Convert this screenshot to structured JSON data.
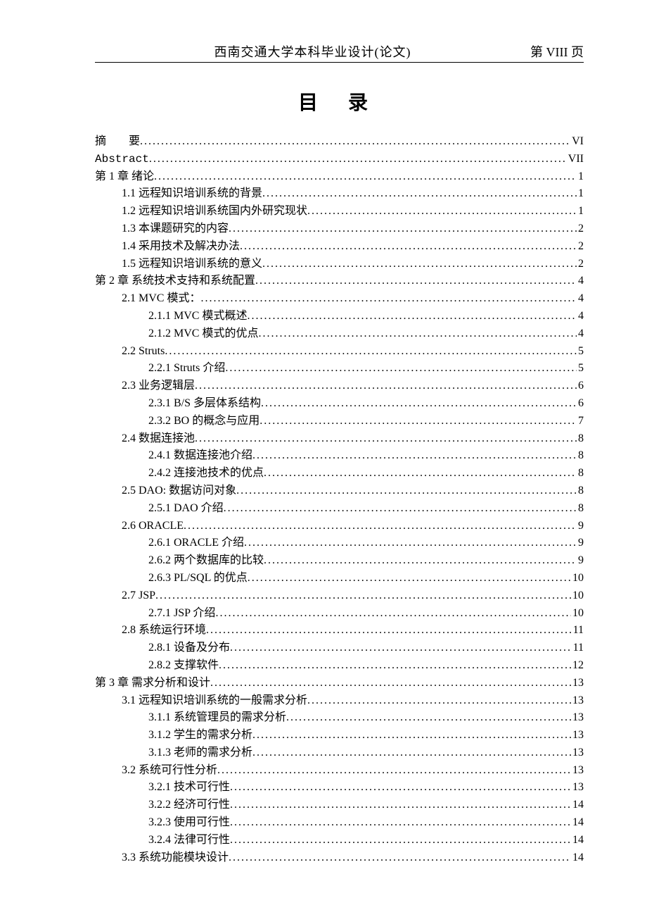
{
  "header": {
    "center": "西南交通大学本科毕业设计(论文)",
    "right": "第 VIII 页"
  },
  "title": "目 录",
  "toc": [
    {
      "level": 0,
      "label": "摘　　要",
      "page": "VI"
    },
    {
      "level": 0,
      "label": "Abstract",
      "page": "VII",
      "latin": true
    },
    {
      "level": 0,
      "label": "第 1 章 绪论",
      "page": "1"
    },
    {
      "level": 1,
      "label": "1.1 远程知识培训系统的背景 ",
      "page": "1"
    },
    {
      "level": 1,
      "label": "1.2 远程知识培训系统国内外研究现状 ",
      "page": "1"
    },
    {
      "level": 1,
      "label": "1.3 本课题研究的内容 ",
      "page": "2"
    },
    {
      "level": 1,
      "label": "1.4 采用技术及解决办法 ",
      "page": "2"
    },
    {
      "level": 1,
      "label": "1.5 远程知识培训系统的意义 ",
      "page": "2"
    },
    {
      "level": 0,
      "label": "第 2 章 系统技术支持和系统配置",
      "page": "4"
    },
    {
      "level": 1,
      "label": "2.1 MVC 模式：",
      "page": "4"
    },
    {
      "level": 2,
      "label": "2.1.1 MVC 模式概述 ",
      "page": "4"
    },
    {
      "level": 2,
      "label": "2.1.2 MVC 模式的优点 ",
      "page": "4"
    },
    {
      "level": 1,
      "label": "2.2 Struts ",
      "page": "5"
    },
    {
      "level": 2,
      "label": "2.2.1 Struts 介绍 ",
      "page": "5"
    },
    {
      "level": 1,
      "label": "2.3 业务逻辑层 ",
      "page": "6"
    },
    {
      "level": 2,
      "label": "2.3.1 B/S 多层体系结构 ",
      "page": "6"
    },
    {
      "level": 2,
      "label": "2.3.2 BO 的概念与应用 ",
      "page": "7"
    },
    {
      "level": 1,
      "label": "2.4 数据连接池 ",
      "page": "8"
    },
    {
      "level": 2,
      "label": "2.4.1 数据连接池介绍",
      "page": "8"
    },
    {
      "level": 2,
      "label": "2.4.2 连接池技术的优点",
      "page": "8"
    },
    {
      "level": 1,
      "label": "2.5 DAO: 数据访问对象 ",
      "page": "8"
    },
    {
      "level": 2,
      "label": "2.5.1 DAO 介绍 ",
      "page": "8"
    },
    {
      "level": 1,
      "label": "2.6 ORACLE ",
      "page": "9"
    },
    {
      "level": 2,
      "label": "2.6.1 ORACLE 介绍 ",
      "page": "9"
    },
    {
      "level": 2,
      "label": "2.6.2 两个数据库的比较",
      "page": "9"
    },
    {
      "level": 2,
      "label": "2.6.3 PL/SQL 的优点 ",
      "page": "10"
    },
    {
      "level": 1,
      "label": "2.7 JSP ",
      "page": "10"
    },
    {
      "level": 2,
      "label": "2.7.1 JSP 介绍 ",
      "page": "10"
    },
    {
      "level": 1,
      "label": "2.8 系统运行环境",
      "page": "11"
    },
    {
      "level": 2,
      "label": "2.8.1 设备及分布 ",
      "page": "11"
    },
    {
      "level": 2,
      "label": "2.8.2 支撑软件 ",
      "page": "12"
    },
    {
      "level": 0,
      "label": "第 3 章 需求分析和设计",
      "page": "13"
    },
    {
      "level": 1,
      "label": "3.1 远程知识培训系统的一般需求分析",
      "page": "13"
    },
    {
      "level": 2,
      "label": "3.1.1 系统管理员的需求分析",
      "page": "13"
    },
    {
      "level": 2,
      "label": "3.1.2 学生的需求分析",
      "page": "13"
    },
    {
      "level": 2,
      "label": "3.1.3 老师的需求分析",
      "page": "13"
    },
    {
      "level": 1,
      "label": "3.2 系统可行性分析",
      "page": "13"
    },
    {
      "level": 2,
      "label": "3.2.1 技术可行性",
      "page": "13"
    },
    {
      "level": 2,
      "label": "3.2.2 经济可行性",
      "page": "14"
    },
    {
      "level": 2,
      "label": "3.2.3 使用可行性",
      "page": "14"
    },
    {
      "level": 2,
      "label": "3.2.4 法律可行性",
      "page": "14"
    },
    {
      "level": 1,
      "label": "3.3 系统功能模块设计 ",
      "page": "14"
    }
  ]
}
